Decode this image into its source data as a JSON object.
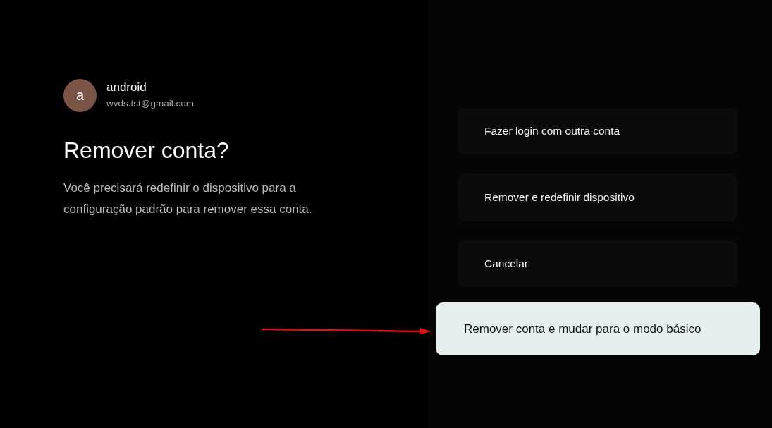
{
  "account": {
    "avatar_letter": "a",
    "name": "android",
    "email": "wvds.tst@gmail.com"
  },
  "title": "Remover conta?",
  "description": "Você precisará redefinir o dispositivo para a configuração padrão para remover essa conta.",
  "options": [
    {
      "label": "Fazer login com outra conta",
      "selected": false
    },
    {
      "label": "Remover e redefinir dispositivo",
      "selected": false
    },
    {
      "label": "Cancelar",
      "selected": false
    },
    {
      "label": "Remover conta e mudar para o modo básico",
      "selected": true
    }
  ]
}
